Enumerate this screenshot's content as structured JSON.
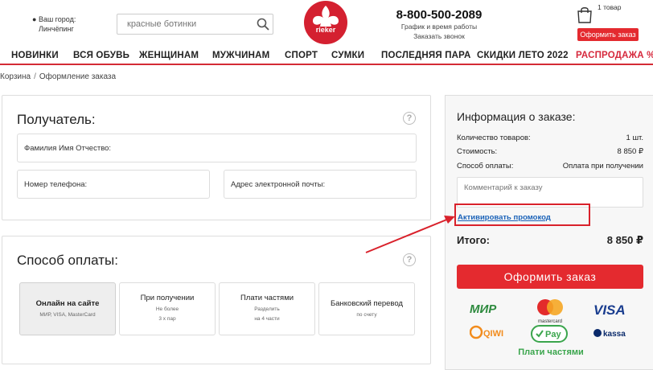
{
  "header": {
    "city_label": "Ваш город:",
    "city_name": "Линчёпинг",
    "search_placeholder": "красные ботинки",
    "logo_text": "rieker",
    "phone": "8-800-500-2089",
    "schedule_link": "График и время работы",
    "callback_link": "Заказать звонок",
    "cart_count": "1 товар",
    "order_button": "Оформить заказ"
  },
  "nav": {
    "items": [
      {
        "label": "НОВИНКИ"
      },
      {
        "label": "ВСЯ ОБУВЬ"
      },
      {
        "label": "ЖЕНЩИНАМ"
      },
      {
        "label": "МУЖЧИНАМ"
      },
      {
        "label": "СПОРТ"
      },
      {
        "label": "СУМКИ"
      },
      {
        "label": "ПОСЛЕДНЯЯ ПАРА"
      },
      {
        "label": "СКИДКИ ЛЕТО 2022"
      },
      {
        "label": "РАСПРОДАЖА %"
      }
    ]
  },
  "breadcrumb": {
    "cart": "Корзина",
    "separator": "/",
    "current": "Оформление заказа"
  },
  "recipient": {
    "title": "Получатель:",
    "help": "?",
    "name_placeholder": "Фамилия Имя Отчество:",
    "phone_placeholder": "Номер телефона:",
    "email_placeholder": "Адрес электронной почты:"
  },
  "payment": {
    "title": "Способ оплаты:",
    "help": "?",
    "options": [
      {
        "title": "Онлайн на сайте",
        "line1": "МИР, VISA, MasterCard",
        "line2": ""
      },
      {
        "title": "При получении",
        "line1": "Не более",
        "line2": "3 х пар"
      },
      {
        "title": "Плати частями",
        "line1": "Разделить",
        "line2": "на 4 части"
      },
      {
        "title": "Банковский перевод",
        "line1": "по счету",
        "line2": ""
      }
    ]
  },
  "order_info": {
    "title": "Информация о заказе:",
    "qty_label": "Количество товаров:",
    "qty_value": "1 шт.",
    "cost_label": "Стоимость:",
    "cost_value": "8 850 ₽",
    "payment_label": "Способ оплаты:",
    "payment_value": "Оплата при получении",
    "comment_placeholder": "Комментарий к заказу",
    "promo_link": "Активировать промокод",
    "total_label": "Итого:",
    "total_value": "8 850 ₽",
    "submit_button": "Оформить заказ",
    "logos": {
      "mir": "МИР",
      "mastercard": "mastercard",
      "visa": "VISA",
      "qiwi": "QIWI",
      "gpay": "Pay",
      "yukassa": "kassa"
    },
    "installments": "Плати частями"
  },
  "colors": {
    "accent_red": "#e42a2f",
    "nav_underline": "#d42b35",
    "link_blue": "#1a62b8",
    "installments_green": "#3aa54c"
  }
}
